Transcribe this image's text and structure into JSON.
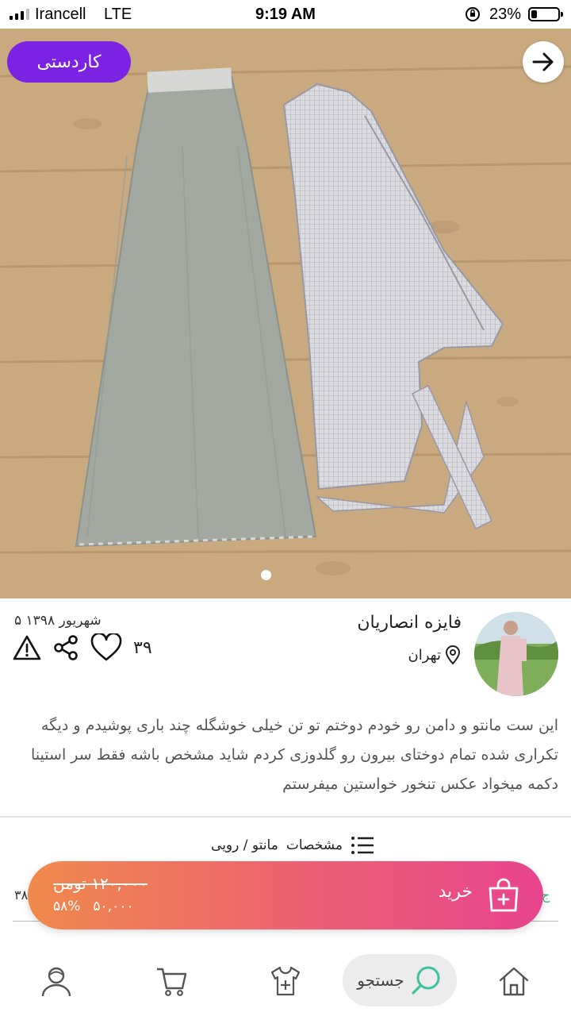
{
  "status_bar": {
    "carrier": "Irancell",
    "network": "LTE",
    "time": "9:19 AM",
    "battery_percent": "23%",
    "battery_level": 0.23
  },
  "product": {
    "badge": "کاردستی",
    "image_count": 1,
    "current_image": 1
  },
  "seller": {
    "name": "فایزه انصاریان",
    "location": "تهران"
  },
  "post": {
    "date": "شهریور ۱۳۹۸ ۵",
    "likes": "۳۹"
  },
  "description": "این ست مانتو و دامن رو خودم دوختم تو تن خیلی خوشگله چند باری پوشیدم و دیگه تکراری شده تمام دوختای بیرون رو گلدوزی کردم شاید مشخص باشه فقط سر استینا دکمه میخواد عکس تنخور خواستین میفرستم",
  "specs": {
    "label": "مشخصات",
    "category": "مانتو / رویی"
  },
  "peek": {
    "left": "۳۸",
    "right": "ج"
  },
  "buy_bar": {
    "buy_label": "خرید",
    "old_price": "۱۲۰,۰۰۰ تومن",
    "new_price": "۵۰,۰۰۰",
    "discount": "۵۸%"
  },
  "bottom_nav": {
    "search_label": "جستجو",
    "items": [
      "home-icon",
      "search-icon",
      "add-product-icon",
      "cart-icon",
      "profile-icon"
    ]
  },
  "colors": {
    "badge": "#7b22e3",
    "buy_gradient_start": "#f08a4b",
    "buy_gradient_end": "#e8448e",
    "search_accent": "#3ec49a"
  }
}
